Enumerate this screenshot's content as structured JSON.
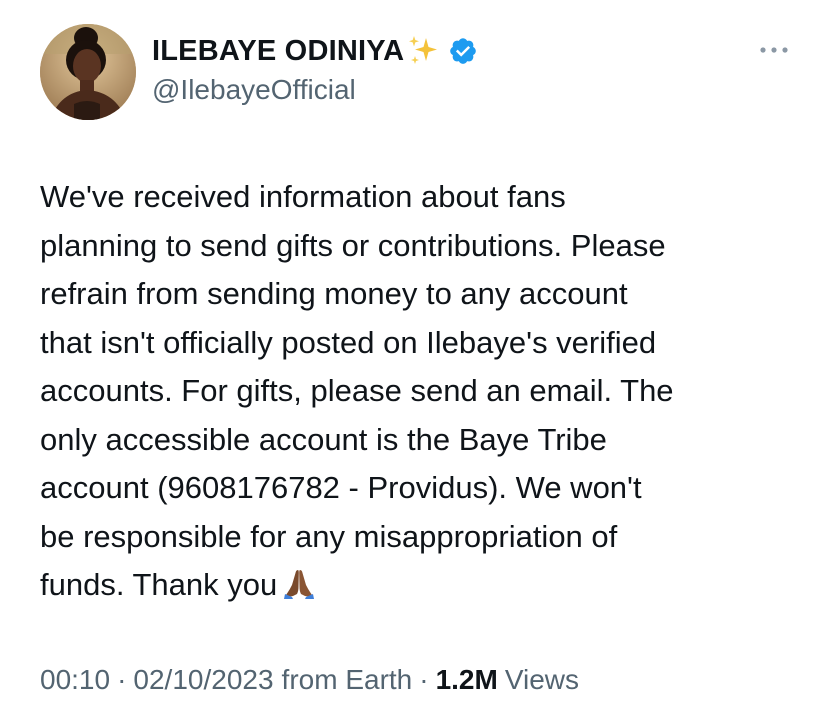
{
  "author": {
    "display_name": "ILEBAYE ODINIYA",
    "handle": "@IlebayeOfficial",
    "verified": true,
    "name_emoji": "sparkles-icon",
    "avatar": "profile-photo"
  },
  "tweet": {
    "text": "We've received information about fans\nplanning to send gifts or contributions. Please\nrefrain from sending money to any account\nthat isn't officially posted on Ilebaye's verified\naccounts. For gifts, please send an email. The\nonly accessible account is the Baye Tribe\naccount (9608176782 - Providus). We won't\nbe responsible for any misappropriation of\nfunds. Thank you",
    "trailing_emoji": "folded-hands-icon"
  },
  "meta": {
    "time": "00:10",
    "separator": "·",
    "date": "02/10/2023",
    "location": "from Earth",
    "views_count": "1.2M",
    "views_label": "Views"
  },
  "colors": {
    "text": "#0f1419",
    "secondary": "#536471",
    "verified": "#1d9bf0",
    "background": "#ffffff"
  }
}
